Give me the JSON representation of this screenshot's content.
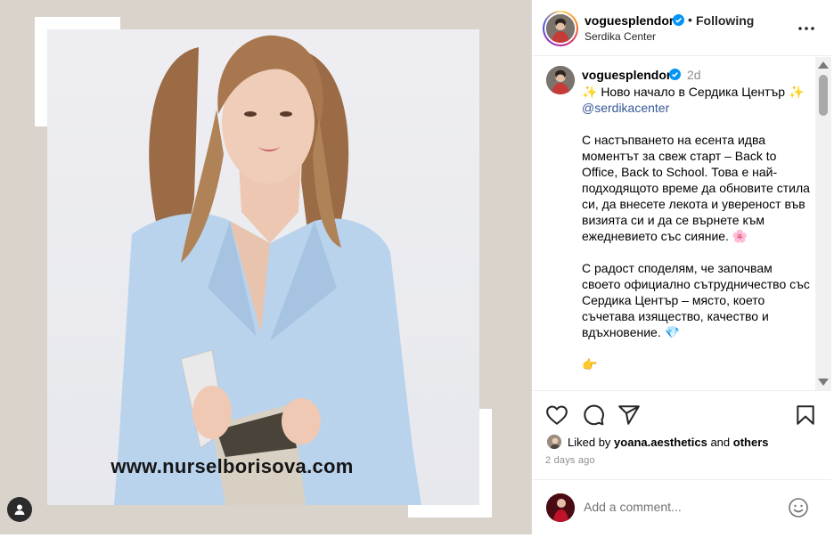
{
  "colors": {
    "media_background": "#d9d3cc",
    "verified_badge": "#0095f6",
    "link": "#385898",
    "secondary_text": "#8e8e8e"
  },
  "media": {
    "watermark": "www.nurselborisova.com",
    "icons": {
      "tags": "user-tag-icon"
    }
  },
  "header": {
    "username": "voguesplendor",
    "separator": "•",
    "follow_status": "Following",
    "location": "Serdika Center",
    "icons": {
      "verified": "verified-badge-icon",
      "more": "more-options-icon"
    }
  },
  "caption": {
    "username": "voguesplendor",
    "time": "2d",
    "title_line": "✨ Ново начало в Сердика Център ✨",
    "mention": "@serdikacenter",
    "paragraph_1": "С настъпването на есента идва моментът за свеж старт – Back to Office, Back to School. Това е най-подходящото време да обновите стила си, да внесете лекота и увереност във визията си и да се върнете към ежедневието със сияние. 🌸",
    "paragraph_2": "С радост споделям, че започвам своето официално сътрудничество със Сердика Център – място, което съчетава изящество, качество и вдъхновение. 💎",
    "paragraph_3_partial": "👉"
  },
  "actions": {
    "icons": [
      "heart-icon",
      "comment-icon",
      "share-icon",
      "bookmark-icon"
    ]
  },
  "likes": {
    "prefix": "Liked by",
    "user": "yoana.aesthetics",
    "conjunction": "and",
    "others": "others"
  },
  "post_age": "2 days ago",
  "comment_box": {
    "placeholder": "Add a comment...",
    "icons": {
      "emoji": "emoji-icon"
    }
  }
}
